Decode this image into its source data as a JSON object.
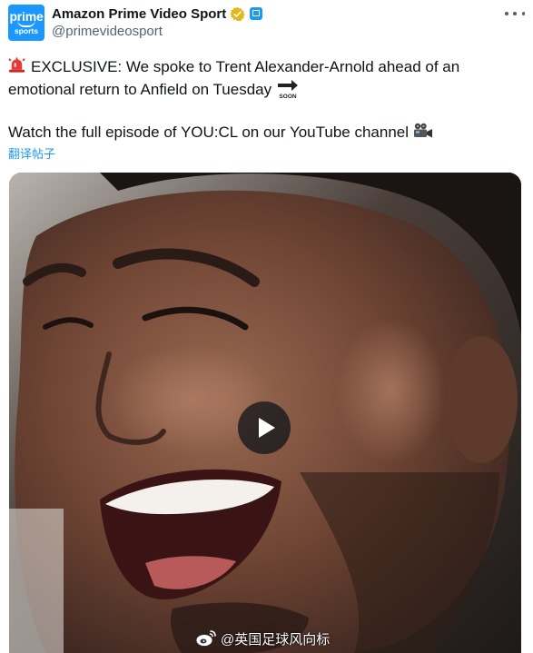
{
  "account": {
    "display_name": "Amazon Prime Video Sport",
    "handle": "@primevideosport",
    "avatar_text_top": "prime",
    "avatar_text_bottom": "sports",
    "verified_badge_color": "#f4b400",
    "affiliate_badge_color": "#1d9bf0"
  },
  "tweet": {
    "line1": "EXCLUSIVE: We spoke to Trent Alexander-Arnold ahead of an emotional return to Anfield on Tuesday",
    "line2": "Watch the full episode of YOU:CL on our YouTube channel",
    "emoji_1": "siren-icon",
    "emoji_2": "soon-arrow-icon",
    "emoji_3": "movie-camera-icon",
    "soon_label": "SOON"
  },
  "translate_link": "翻译帖子",
  "media": {
    "type": "video",
    "play_icon": "play-icon"
  },
  "watermark": {
    "text": "@英国足球风向标",
    "icon": "weibo-icon"
  },
  "colors": {
    "link": "#1d9bf0",
    "secondary_text": "#536471",
    "primary_text": "#0f1419",
    "avatar_bg": "#1a98ff"
  }
}
